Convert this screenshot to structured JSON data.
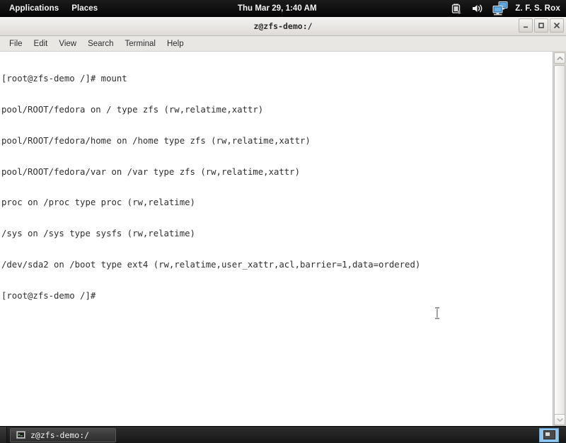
{
  "top_panel": {
    "menus": [
      {
        "label": "Applications",
        "name": "applications-menu"
      },
      {
        "label": "Places",
        "name": "places-menu"
      }
    ],
    "clock": "Thu Mar 29,  1:40 AM",
    "tray": [
      {
        "name": "battery-icon",
        "title": "battery"
      },
      {
        "name": "volume-icon",
        "title": "volume"
      },
      {
        "name": "network-monitor-icon",
        "title": "network"
      }
    ],
    "user": "Z. F. S. Rox"
  },
  "window": {
    "title": "z@zfs-demo:/",
    "controls": [
      {
        "name": "minimize-button",
        "glyph": "–"
      },
      {
        "name": "maximize-button",
        "glyph": "□"
      },
      {
        "name": "close-button",
        "glyph": "✕"
      }
    ],
    "menubar": [
      {
        "label": "File",
        "name": "menu-file"
      },
      {
        "label": "Edit",
        "name": "menu-edit"
      },
      {
        "label": "View",
        "name": "menu-view"
      },
      {
        "label": "Search",
        "name": "menu-search"
      },
      {
        "label": "Terminal",
        "name": "menu-terminal"
      },
      {
        "label": "Help",
        "name": "menu-help"
      }
    ]
  },
  "terminal": {
    "lines": [
      "[root@zfs-demo /]# mount",
      "pool/ROOT/fedora on / type zfs (rw,relatime,xattr)",
      "pool/ROOT/fedora/home on /home type zfs (rw,relatime,xattr)",
      "pool/ROOT/fedora/var on /var type zfs (rw,relatime,xattr)",
      "proc on /proc type proc (rw,relatime)",
      "/sys on /sys type sysfs (rw,relatime)",
      "/dev/sda2 on /boot type ext4 (rw,relatime,user_xattr,acl,barrier=1,data=ordered)",
      "[root@zfs-demo /]#"
    ],
    "text_color": "#2f2f2f",
    "background_color": "#ffffff"
  },
  "bottom_panel": {
    "tasks": [
      {
        "label": "z@zfs-demo:/",
        "name": "task-button-terminal",
        "icon": "terminal-icon"
      }
    ],
    "workspaces": [
      {
        "name": "workspace-1",
        "active": true
      }
    ]
  }
}
